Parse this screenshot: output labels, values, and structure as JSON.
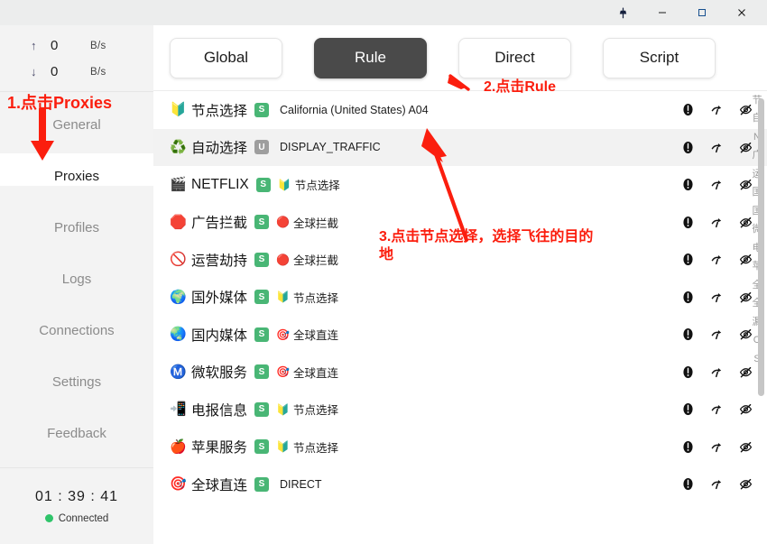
{
  "window": {
    "controls": [
      {
        "name": "pin",
        "glyph": "pin-icon"
      },
      {
        "name": "minimize",
        "glyph": "minimize-icon"
      },
      {
        "name": "maximize",
        "glyph": "maximize-icon"
      },
      {
        "name": "close",
        "glyph": "close-icon"
      }
    ]
  },
  "sidebar": {
    "traffic": {
      "upload": {
        "arrow": "↑",
        "value": "0",
        "unit": "B/s"
      },
      "download": {
        "arrow": "↓",
        "value": "0",
        "unit": "B/s"
      }
    },
    "nav": [
      {
        "label": "General",
        "active": false
      },
      {
        "label": "Proxies",
        "active": true
      },
      {
        "label": "Profiles",
        "active": false
      },
      {
        "label": "Logs",
        "active": false
      },
      {
        "label": "Connections",
        "active": false
      },
      {
        "label": "Settings",
        "active": false
      },
      {
        "label": "Feedback",
        "active": false
      }
    ],
    "status": {
      "clock": "01 : 39 : 41",
      "connection": "Connected",
      "connection_color": "#2fc46a"
    }
  },
  "main": {
    "modes": [
      {
        "label": "Global",
        "selected": false
      },
      {
        "label": "Rule",
        "selected": true
      },
      {
        "label": "Direct",
        "selected": false
      },
      {
        "label": "Script",
        "selected": false
      }
    ],
    "selected_mode_color": "#4a4a4a",
    "rows": [
      {
        "emoji": "🔰",
        "name": "节点选择",
        "type": "S",
        "current": "California (United States) A04",
        "current_emoji": "",
        "highlight": false
      },
      {
        "emoji": "♻️",
        "name": "自动选择",
        "type": "U",
        "current": "DISPLAY_TRAFFIC",
        "current_emoji": "",
        "highlight": true
      },
      {
        "emoji": "🎬",
        "name": "NETFLIX",
        "type": "S",
        "current": "节点选择",
        "current_emoji": "🔰",
        "highlight": false
      },
      {
        "emoji": "🛑",
        "name": "广告拦截",
        "type": "S",
        "current": "全球拦截",
        "current_emoji": "🔴",
        "highlight": false
      },
      {
        "emoji": "🚫",
        "name": "运营劫持",
        "type": "S",
        "current": "全球拦截",
        "current_emoji": "🔴",
        "highlight": false
      },
      {
        "emoji": "🌍",
        "name": "国外媒体",
        "type": "S",
        "current": "节点选择",
        "current_emoji": "🔰",
        "highlight": false
      },
      {
        "emoji": "🌏",
        "name": "国内媒体",
        "type": "S",
        "current": "全球直连",
        "current_emoji": "🎯",
        "highlight": false
      },
      {
        "emoji": "Ⓜ️",
        "name": "微软服务",
        "type": "S",
        "current": "全球直连",
        "current_emoji": "🎯",
        "highlight": false
      },
      {
        "emoji": "📲",
        "name": "电报信息",
        "type": "S",
        "current": "节点选择",
        "current_emoji": "🔰",
        "highlight": false
      },
      {
        "emoji": "🍎",
        "name": "苹果服务",
        "type": "S",
        "current": "节点选择",
        "current_emoji": "🔰",
        "highlight": false
      },
      {
        "emoji": "🎯",
        "name": "全球直连",
        "type": "S",
        "current": "DIRECT",
        "current_emoji": "",
        "highlight": false
      }
    ],
    "row_actions": [
      {
        "name": "info-icon"
      },
      {
        "name": "speed-test-icon"
      },
      {
        "name": "hide-eye-icon"
      }
    ],
    "badge_colors": {
      "S": "#49b675",
      "U": "#9e9e9e"
    }
  },
  "index_rail": [
    "节",
    "自",
    "N",
    "广",
    "运",
    "国",
    "国",
    "微",
    "电",
    "苹",
    "全",
    "全",
    "漏",
    "O",
    "S"
  ],
  "annotations": {
    "color": "#fb1e0e",
    "step1": "1.点击Proxies",
    "step2": "2.点击Rule",
    "step3": "3.点击节点选择，选择飞往的目的地"
  }
}
